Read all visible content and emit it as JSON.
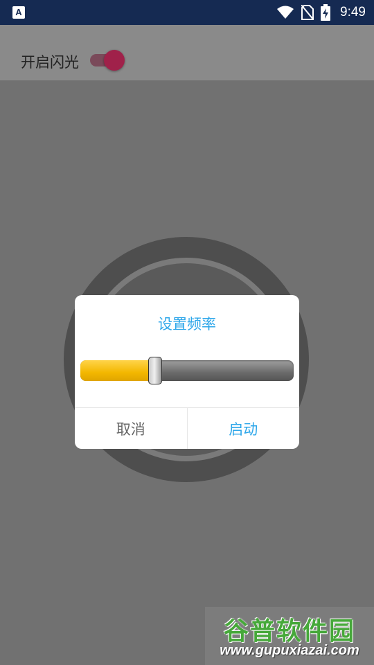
{
  "status_bar": {
    "app_icon_letter": "A",
    "time": "9:49",
    "icons": [
      "wifi-icon",
      "no-sim-icon",
      "battery-charging-icon"
    ]
  },
  "toggle": {
    "label": "开启闪光",
    "state": "on",
    "accent_color": "#a0214a"
  },
  "dialog": {
    "title": "设置频率",
    "slider_value": 0.35,
    "cancel_label": "取消",
    "start_label": "启动",
    "accent_color": "#2ea7ea",
    "slider_color": "#f3b700"
  },
  "watermark": {
    "brand": "谷普软件园",
    "url": "www.gupuxiazai.com"
  }
}
